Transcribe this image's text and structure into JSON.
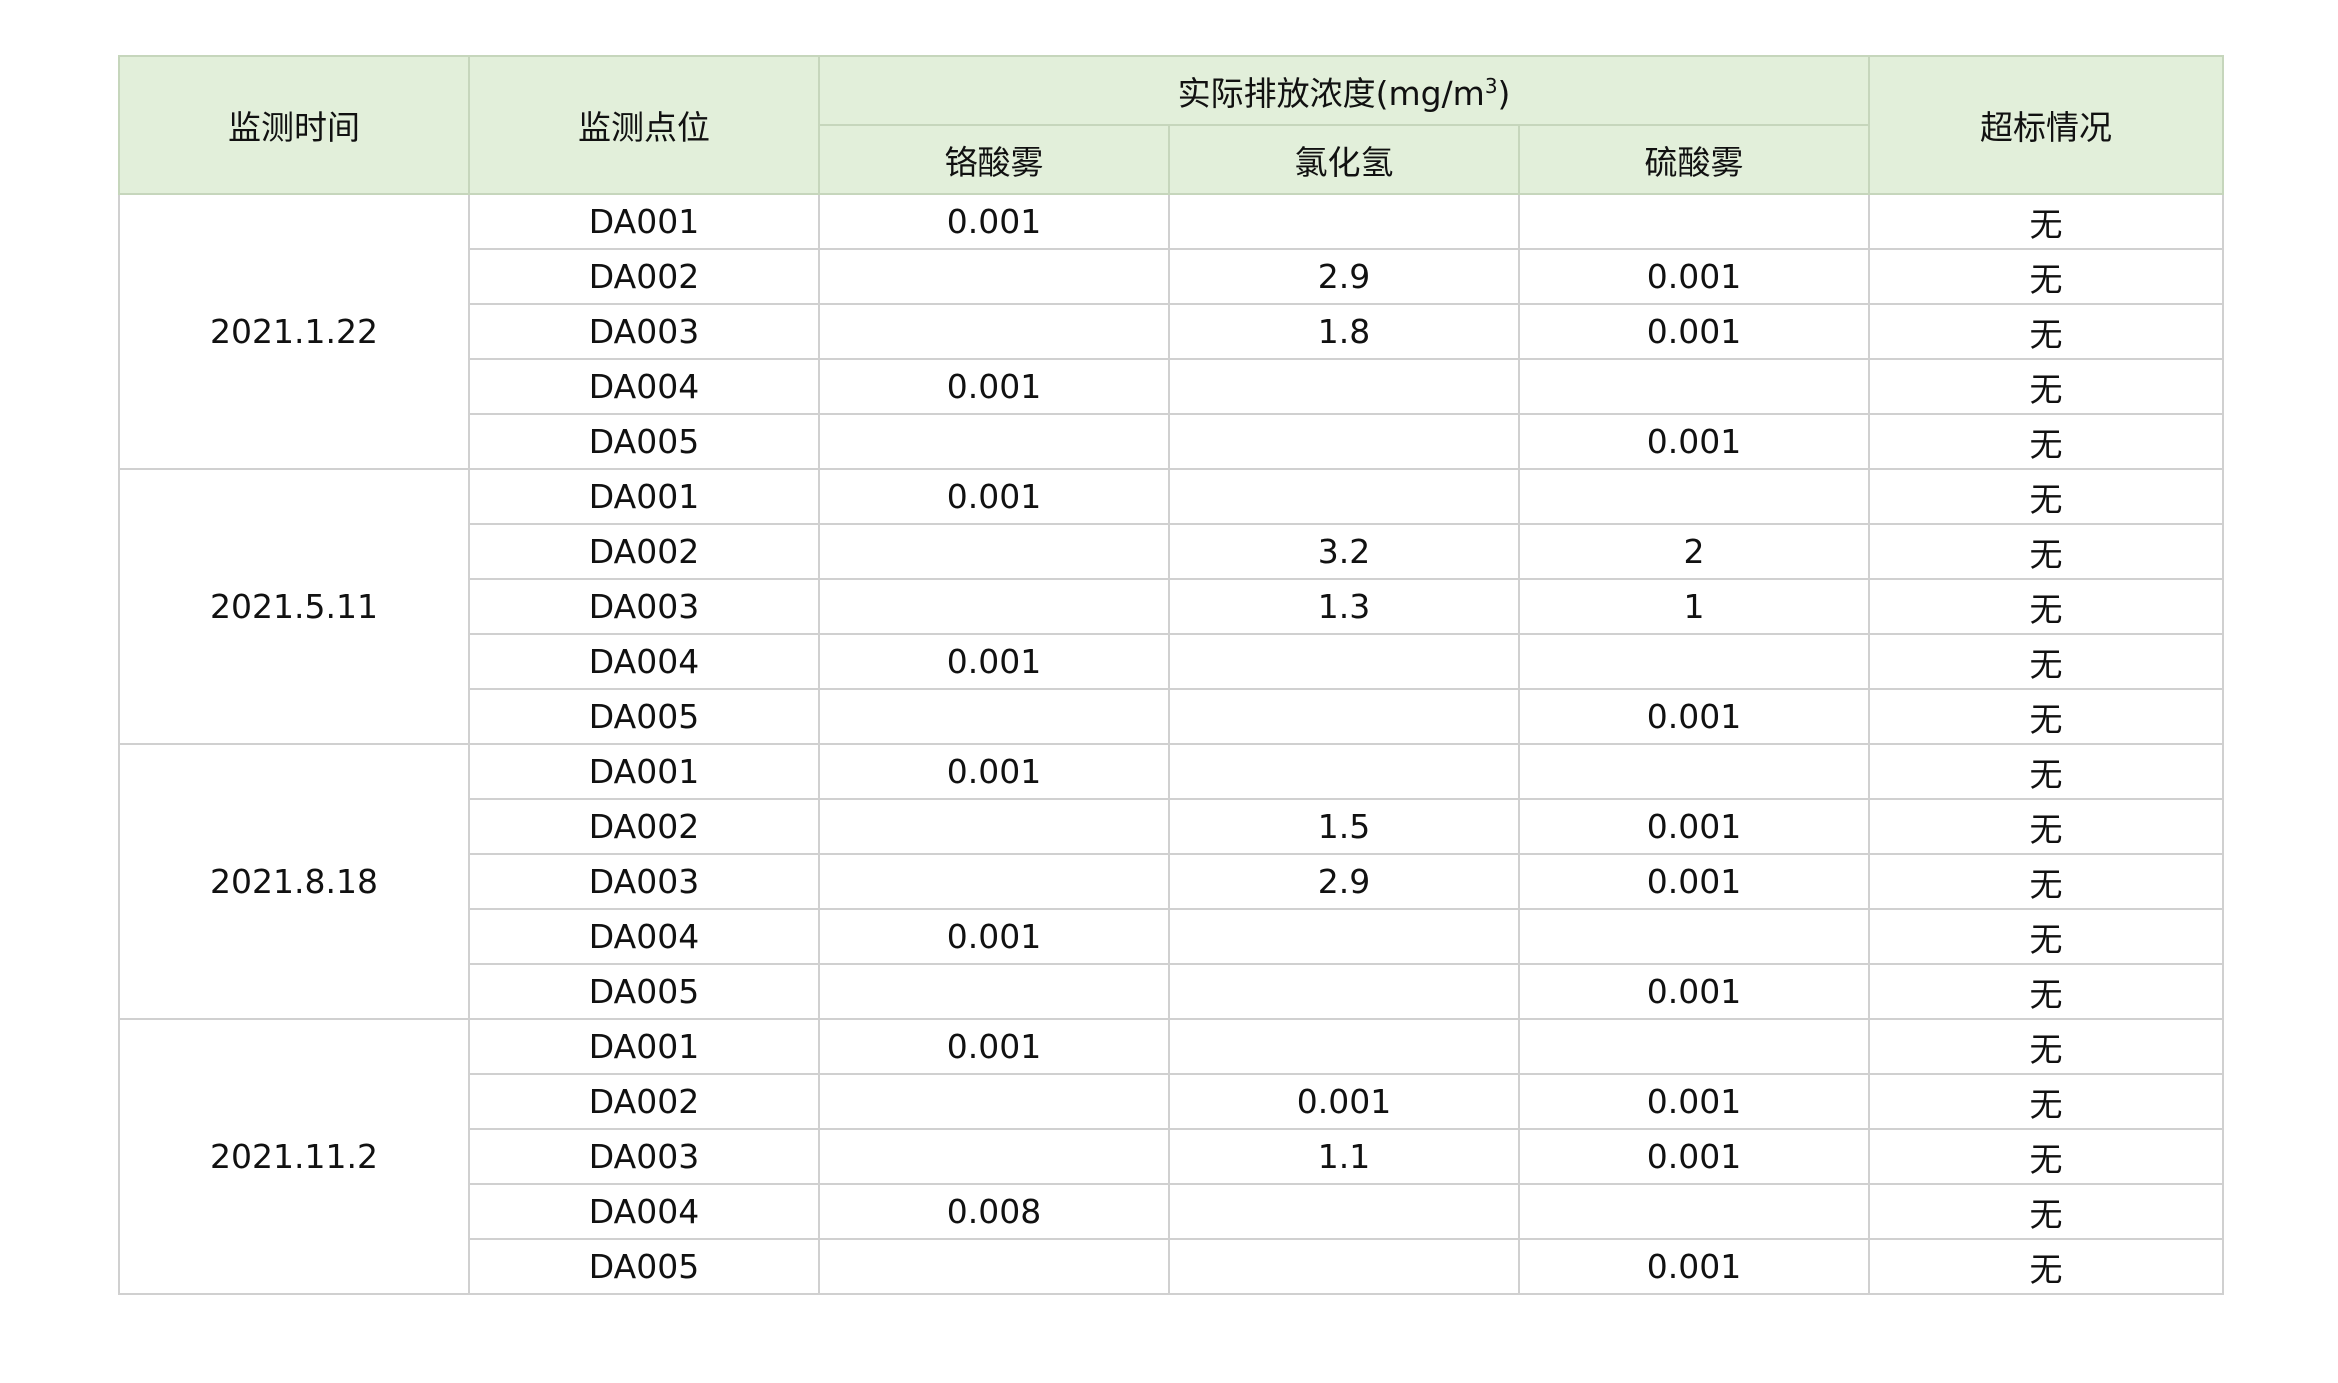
{
  "header": {
    "col_time": "监测时间",
    "col_point": "监测点位",
    "group_title": "实际排放浓度(mg/m",
    "group_title_exp": "3",
    "group_title_close": ")",
    "sub_chromic": "铬酸雾",
    "sub_hcl": "氯化氢",
    "sub_sulfuric": "硫酸雾",
    "col_exceed": "超标情况"
  },
  "groups": [
    {
      "date": "2021.1.22",
      "rows": [
        {
          "point": "DA001",
          "chromic": "0.001",
          "hcl": "",
          "sulfuric": "",
          "exceed": "无"
        },
        {
          "point": "DA002",
          "chromic": "",
          "hcl": "2.9",
          "sulfuric": "0.001",
          "exceed": "无"
        },
        {
          "point": "DA003",
          "chromic": "",
          "hcl": "1.8",
          "sulfuric": "0.001",
          "exceed": "无"
        },
        {
          "point": "DA004",
          "chromic": "0.001",
          "hcl": "",
          "sulfuric": "",
          "exceed": "无"
        },
        {
          "point": "DA005",
          "chromic": "",
          "hcl": "",
          "sulfuric": "0.001",
          "exceed": "无"
        }
      ]
    },
    {
      "date": "2021.5.11",
      "rows": [
        {
          "point": "DA001",
          "chromic": "0.001",
          "hcl": "",
          "sulfuric": "",
          "exceed": "无"
        },
        {
          "point": "DA002",
          "chromic": "",
          "hcl": "3.2",
          "sulfuric": "2",
          "exceed": "无"
        },
        {
          "point": "DA003",
          "chromic": "",
          "hcl": "1.3",
          "sulfuric": "1",
          "exceed": "无"
        },
        {
          "point": "DA004",
          "chromic": "0.001",
          "hcl": "",
          "sulfuric": "",
          "exceed": "无"
        },
        {
          "point": "DA005",
          "chromic": "",
          "hcl": "",
          "sulfuric": "0.001",
          "exceed": "无"
        }
      ]
    },
    {
      "date": "2021.8.18",
      "rows": [
        {
          "point": "DA001",
          "chromic": "0.001",
          "hcl": "",
          "sulfuric": "",
          "exceed": "无"
        },
        {
          "point": "DA002",
          "chromic": "",
          "hcl": "1.5",
          "sulfuric": "0.001",
          "exceed": "无"
        },
        {
          "point": "DA003",
          "chromic": "",
          "hcl": "2.9",
          "sulfuric": "0.001",
          "exceed": "无"
        },
        {
          "point": "DA004",
          "chromic": "0.001",
          "hcl": "",
          "sulfuric": "",
          "exceed": "无"
        },
        {
          "point": "DA005",
          "chromic": "",
          "hcl": "",
          "sulfuric": "0.001",
          "exceed": "无"
        }
      ]
    },
    {
      "date": "2021.11.2",
      "rows": [
        {
          "point": "DA001",
          "chromic": "0.001",
          "hcl": "",
          "sulfuric": "",
          "exceed": "无"
        },
        {
          "point": "DA002",
          "chromic": "",
          "hcl": "0.001",
          "sulfuric": "0.001",
          "exceed": "无"
        },
        {
          "point": "DA003",
          "chromic": "",
          "hcl": "1.1",
          "sulfuric": "0.001",
          "exceed": "无"
        },
        {
          "point": "DA004",
          "chromic": "0.008",
          "hcl": "",
          "sulfuric": "",
          "exceed": "无"
        },
        {
          "point": "DA005",
          "chromic": "",
          "hcl": "",
          "sulfuric": "0.001",
          "exceed": "无"
        }
      ]
    }
  ]
}
